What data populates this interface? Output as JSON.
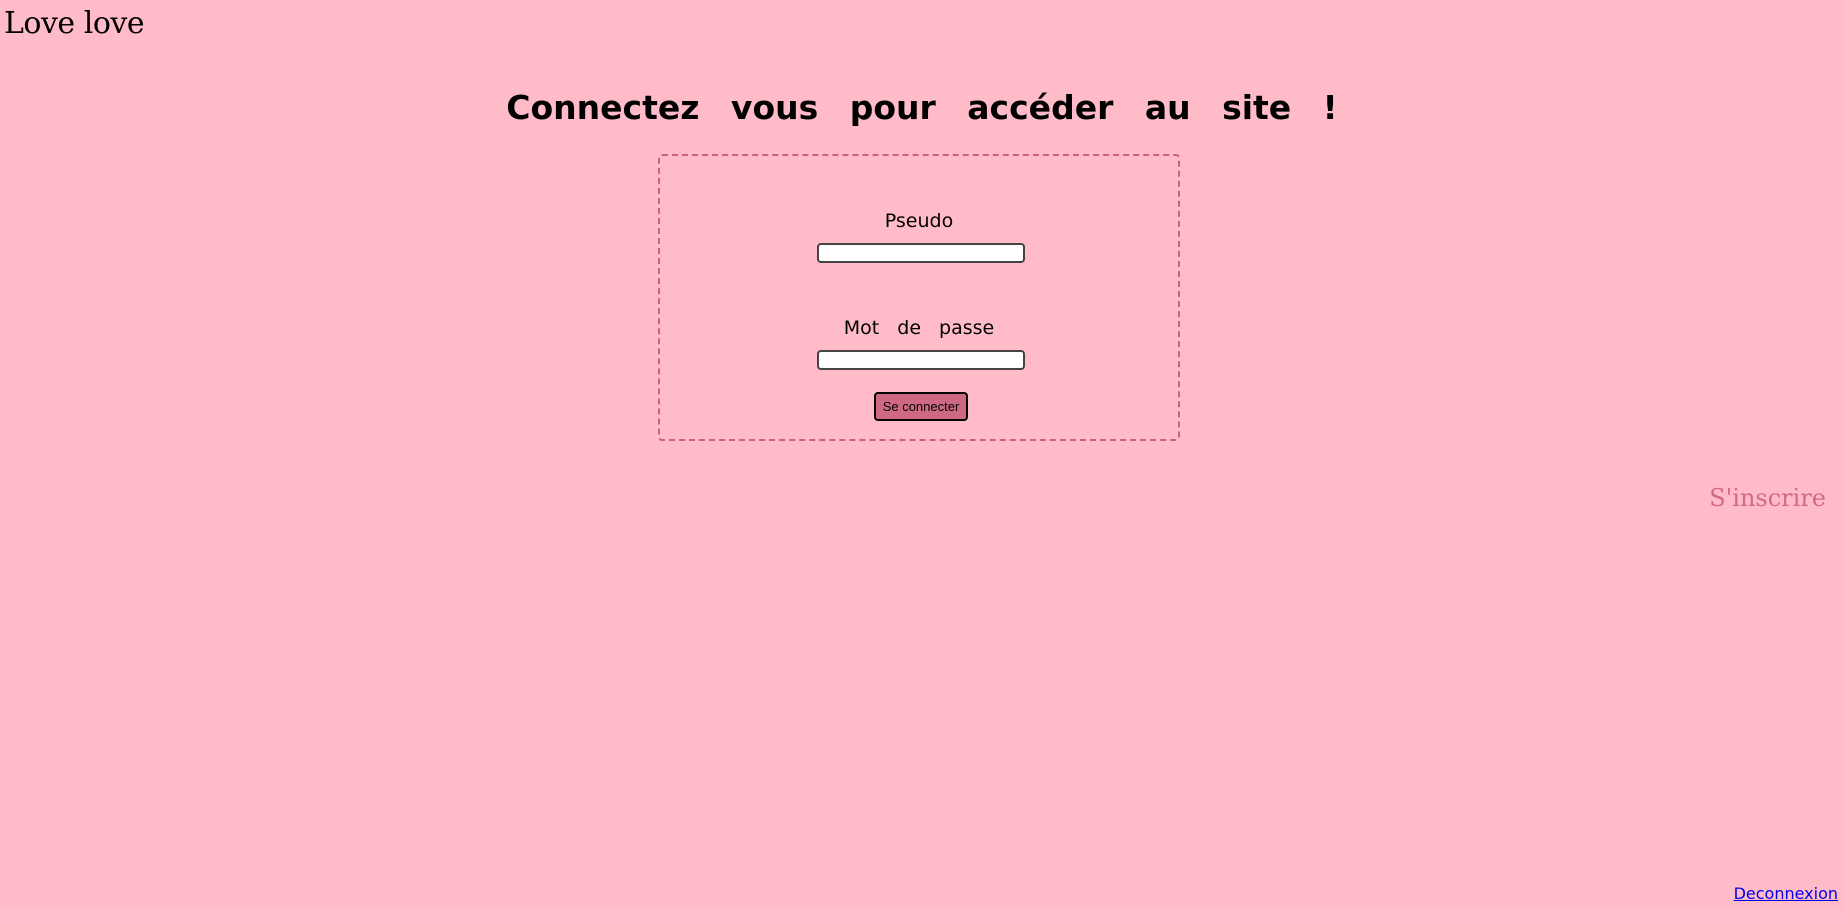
{
  "header": {
    "brand": "Love love"
  },
  "main": {
    "heading": "Connectez vous pour accéder au site !",
    "form": {
      "pseudo_label": "Pseudo",
      "pseudo_value": "",
      "password_label": "Mot de passe",
      "password_value": "",
      "submit_label": "Se connecter"
    }
  },
  "links": {
    "signup": "S'inscrire",
    "logout": "Deconnexion"
  },
  "colors": {
    "background": "#ffbcc8",
    "accent": "#d36a82",
    "button": "#cf6882",
    "box_border": "#c96379"
  }
}
